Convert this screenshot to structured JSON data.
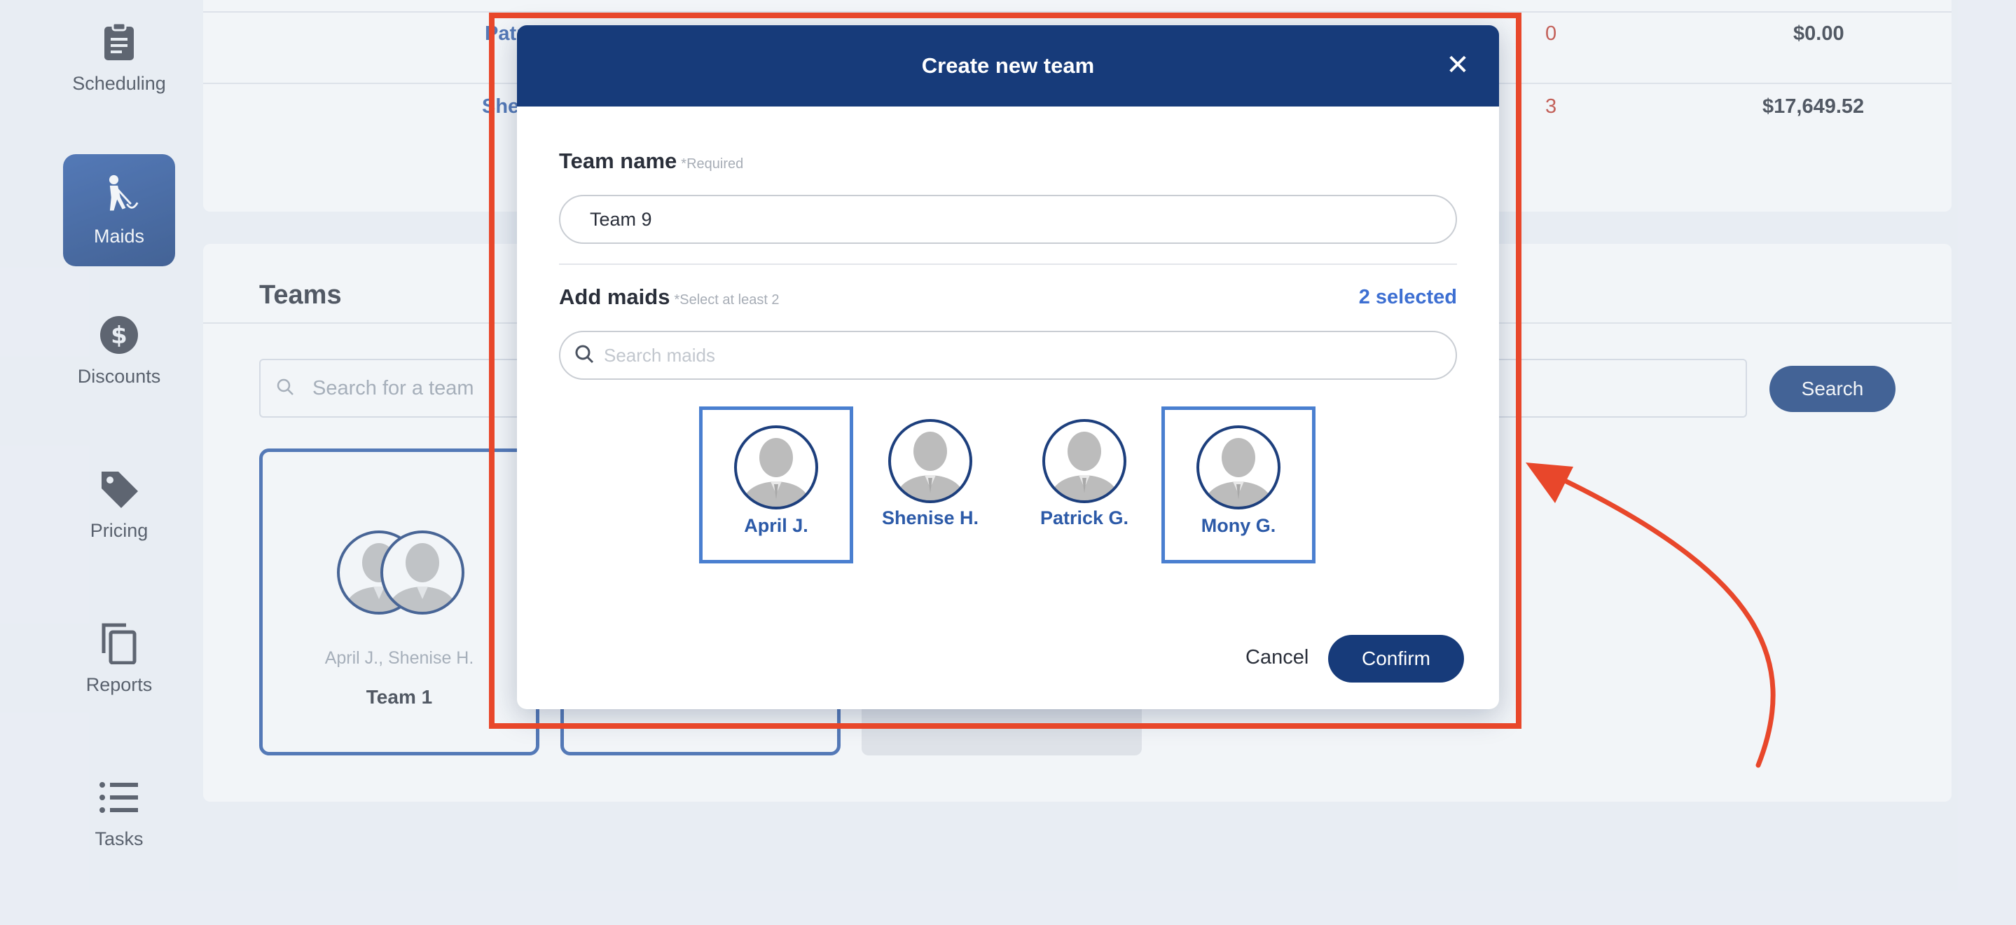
{
  "sidebar": {
    "items": [
      {
        "label": "Scheduling",
        "icon": "clipboard-icon",
        "active": false
      },
      {
        "label": "Maids",
        "icon": "maid-cleaning-icon",
        "active": true
      },
      {
        "label": "Discounts",
        "icon": "dollar-circle-icon",
        "active": false
      },
      {
        "label": "Pricing",
        "icon": "price-tag-icon",
        "active": false
      },
      {
        "label": "Reports",
        "icon": "copy-documents-icon",
        "active": false
      },
      {
        "label": "Tasks",
        "icon": "list-icon",
        "active": false
      }
    ]
  },
  "table": {
    "rows": [
      {
        "name": "Patr",
        "count": "0",
        "amount": "$0.00"
      },
      {
        "name": "Sher",
        "count": "3",
        "amount": "$17,649.52"
      }
    ]
  },
  "teams": {
    "title": "Teams",
    "search_placeholder": "Search for a team",
    "search_button": "Search",
    "cards": [
      {
        "members": "April J., Shenise H.",
        "name": "Team 1"
      }
    ]
  },
  "modal": {
    "title": "Create new team",
    "close_symbol": "✕",
    "team_name_label": "Team name",
    "team_name_hint": "*Required",
    "team_name_value": "Team 9",
    "add_maids_label": "Add maids",
    "add_maids_hint": "*Select at least 2",
    "selected_count": "2 selected",
    "maid_search_placeholder": "Search maids",
    "maids": [
      {
        "name": "April J.",
        "selected": true
      },
      {
        "name": "Shenise H.",
        "selected": false
      },
      {
        "name": "Patrick G.",
        "selected": false
      },
      {
        "name": "Mony G.",
        "selected": true
      }
    ],
    "cancel_label": "Cancel",
    "confirm_label": "Confirm"
  },
  "colors": {
    "primary": "#173b7a",
    "accent": "#3d6fd2",
    "highlight": "#e8472b",
    "negative": "#c0392b"
  }
}
